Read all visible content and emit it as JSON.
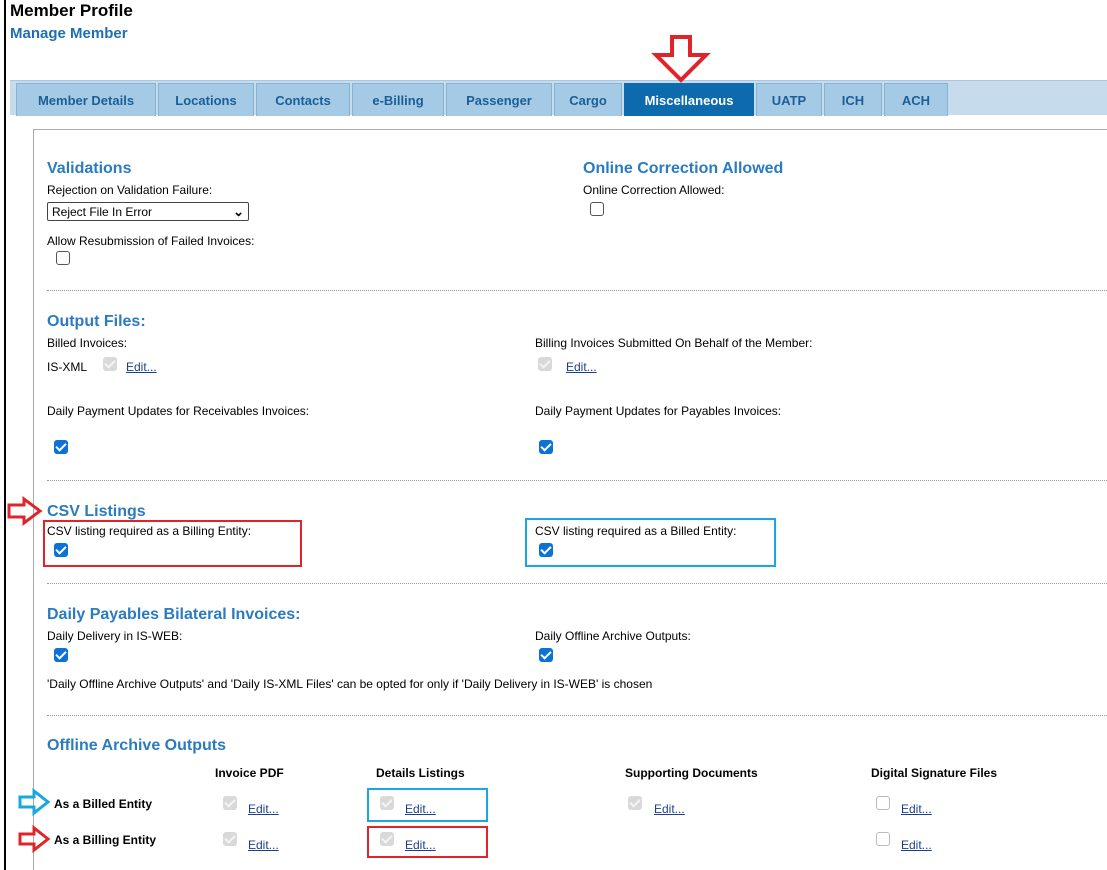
{
  "page": {
    "title": "Member Profile",
    "subtitle": "Manage Member"
  },
  "tabs": [
    {
      "label": "Member Details"
    },
    {
      "label": "Locations"
    },
    {
      "label": "Contacts"
    },
    {
      "label": "e-Billing"
    },
    {
      "label": "Passenger"
    },
    {
      "label": "Cargo"
    },
    {
      "label": "Miscellaneous",
      "active": true
    },
    {
      "label": "UATP"
    },
    {
      "label": "ICH"
    },
    {
      "label": "ACH"
    }
  ],
  "validations": {
    "title": "Validations",
    "rejection_label": "Rejection on Validation Failure:",
    "rejection_value": "Reject File In Error",
    "resubmission_label": "Allow Resubmission of Failed Invoices:",
    "resubmission_checked": false
  },
  "online_correction": {
    "title": "Online Correction Allowed",
    "label": "Online Correction Allowed:",
    "checked": false
  },
  "output_files": {
    "title": "Output Files:",
    "billed_label": "Billed Invoices:",
    "billed_format": "IS-XML",
    "billed_edit": "Edit...",
    "on_behalf_label": "Billing Invoices Submitted On Behalf of the Member:",
    "on_behalf_edit": "Edit...",
    "daily_receivables_label": "Daily Payment Updates for Receivables Invoices:",
    "daily_receivables_checked": true,
    "daily_payables_label": "Daily Payment Updates for Payables Invoices:",
    "daily_payables_checked": true
  },
  "csv_listings": {
    "title": "CSV Listings",
    "billing_entity_label": "CSV listing required as a Billing Entity:",
    "billing_entity_checked": true,
    "billed_entity_label": "CSV listing required as a Billed Entity:",
    "billed_entity_checked": true
  },
  "daily_payables": {
    "title": "Daily Payables Bilateral Invoices:",
    "delivery_label": "Daily Delivery in IS-WEB:",
    "delivery_checked": true,
    "offline_label": "Daily Offline Archive Outputs:",
    "offline_checked": true,
    "note": "'Daily Offline Archive Outputs' and 'Daily IS-XML Files' can be opted for only if 'Daily Delivery in IS-WEB' is chosen"
  },
  "offline_archive": {
    "title": "Offline Archive Outputs",
    "columns": [
      "Invoice PDF",
      "Details Listings",
      "Supporting Documents",
      "Digital Signature Files"
    ],
    "rows": [
      {
        "label": "As a Billed Entity",
        "edits": [
          "Edit...",
          "Edit...",
          "Edit...",
          "Edit..."
        ]
      },
      {
        "label": "As a Billing Entity",
        "edits": [
          "Edit...",
          "Edit...",
          "Edit..."
        ]
      }
    ]
  },
  "annotation_colors": {
    "red": "#e0242c",
    "blue": "#1aa7e0"
  },
  "theme": {
    "accent": "#0d6aad",
    "section_title": "#2a7bbf",
    "tab_bg": "#a5cae6",
    "checkbox": "#0b72d6"
  }
}
